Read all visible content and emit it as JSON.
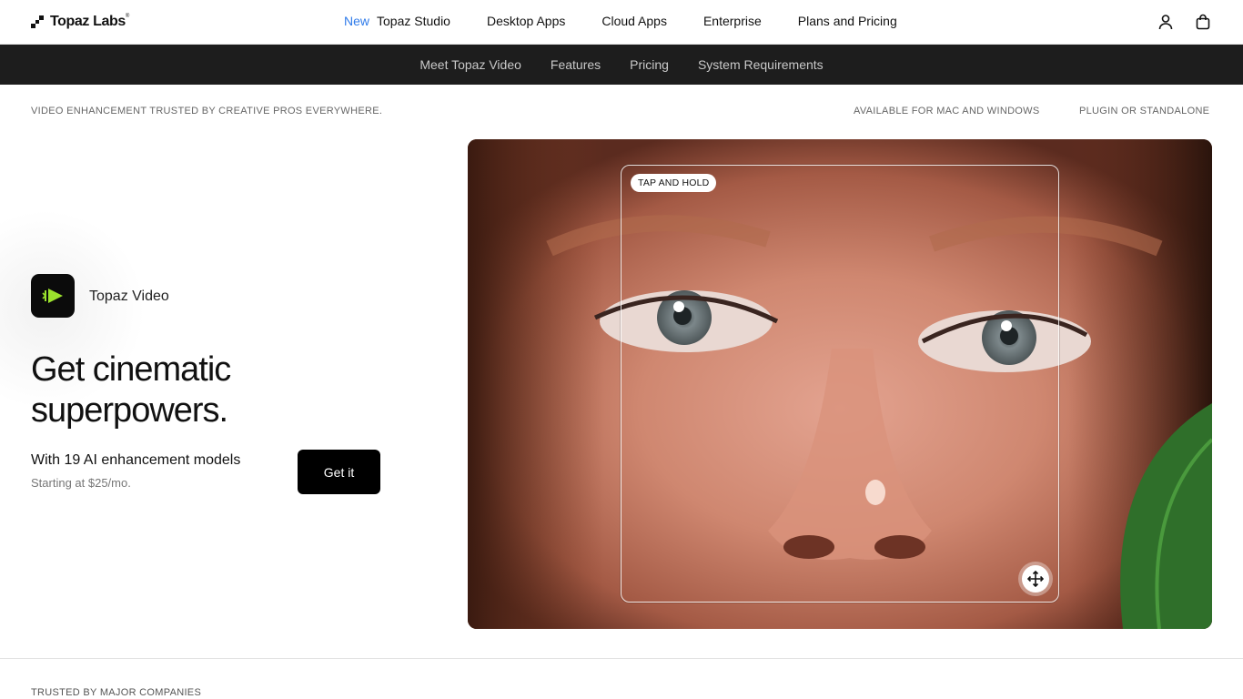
{
  "brand": {
    "name": "Topaz Labs",
    "trademark": "®"
  },
  "top_nav": {
    "new_badge": "New",
    "items": [
      "Topaz Studio",
      "Desktop Apps",
      "Cloud Apps",
      "Enterprise",
      "Plans and Pricing"
    ],
    "icons": [
      "user-icon",
      "shopping-bag-icon"
    ]
  },
  "sub_nav": {
    "items": [
      "Meet Topaz Video",
      "Features",
      "Pricing",
      "System Requirements"
    ]
  },
  "taglines": {
    "left": "VIDEO ENHANCEMENT TRUSTED BY CREATIVE PROS EVERYWHERE.",
    "platforms": "AVAILABLE FOR MAC AND WINDOWS",
    "mode": "PLUGIN OR STANDALONE"
  },
  "hero": {
    "app_icon": "topaz-video-play-icon",
    "app_name": "Topaz Video",
    "title_line1": "Get cinematic",
    "title_line2": "superpowers.",
    "subtitle": "With 19 AI enhancement models",
    "price_note": "Starting at $25/mo.",
    "cta": "Get it",
    "compare_badge": "TAP AND HOLD",
    "compare_handle_icon": "move-arrows-icon"
  },
  "trusted": {
    "label": "TRUSTED BY MAJOR COMPANIES"
  },
  "colors": {
    "accent_green": "#9be22d",
    "new_blue": "#2f7bea",
    "subnav_bg": "#1d1d1d"
  }
}
